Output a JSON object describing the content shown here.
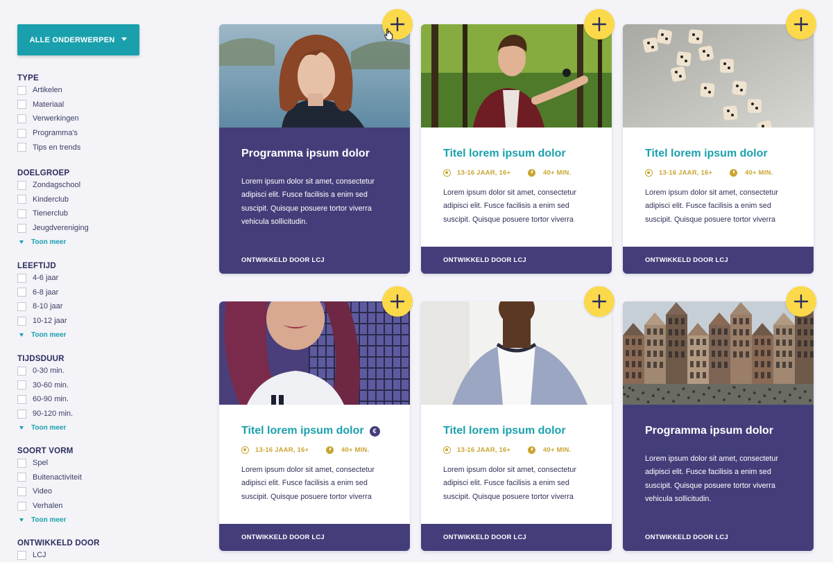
{
  "sidebar": {
    "topic_button": "ALLE ONDERWERPEN",
    "groups": [
      {
        "title": "TYPE",
        "options": [
          "Artikelen",
          "Materiaal",
          "Verwerkingen",
          "Programma's",
          "Tips en trends"
        ],
        "show_more": ""
      },
      {
        "title": "DOELGROEP",
        "options": [
          "Zondagschool",
          "Kinderclub",
          "Tienerclub",
          "Jeugdvereniging"
        ],
        "show_more": "Toon meer"
      },
      {
        "title": "LEEFTIJD",
        "options": [
          "4-6 jaar",
          "6-8 jaar",
          "8-10 jaar",
          "10-12 jaar"
        ],
        "show_more": "Toon meer"
      },
      {
        "title": "TIJDSDUUR",
        "options": [
          "0-30 min.",
          "30-60 min.",
          "60-90 min.",
          "90-120 min."
        ],
        "show_more": "Toon meer"
      },
      {
        "title": "SOORT VORM",
        "options": [
          "Spel",
          "Buitenactiviteit",
          "Video",
          "Verhalen"
        ],
        "show_more": "Toon meer"
      },
      {
        "title": "ONTWIKKELD DOOR",
        "options": [
          "LCJ"
        ],
        "show_more": ""
      }
    ]
  },
  "cards": [
    {
      "variant": "program",
      "image": "girl-portrait",
      "title": "Programma ipsum dolor",
      "euro": false,
      "age": "",
      "duration": "",
      "description": "Lorem ipsum dolor sit amet, consectetur adipisci elit. Fusce facilisis a enim sed suscipit. Quisque posuere tortor viverra vehicula sollicitudin.",
      "footer": "ONTWIKKELD DOOR LCJ"
    },
    {
      "variant": "article",
      "image": "boy-forest",
      "title": "Titel lorem ipsum dolor",
      "euro": false,
      "age": "13-16 JAAR, 16+",
      "duration": "40+ MIN.",
      "description": "Lorem ipsum dolor sit amet, consectetur adipisci elit. Fusce facilisis a enim sed suscipit. Quisque posuere tortor viverra",
      "footer": "ONTWIKKELD DOOR LCJ"
    },
    {
      "variant": "article",
      "image": "dice",
      "title": "Titel lorem ipsum dolor",
      "euro": false,
      "age": "13-16 JAAR, 16+",
      "duration": "40+ MIN.",
      "description": "Lorem ipsum dolor sit amet, consectetur adipisci elit. Fusce facilisis a enim sed suscipit. Quisque posuere tortor viverra",
      "footer": "ONTWIKKELD DOOR LCJ"
    },
    {
      "variant": "article",
      "image": "girl-fence",
      "title": "Titel lorem ipsum dolor",
      "euro": true,
      "euro_label": "€",
      "age": "13-16 JAAR, 16+",
      "duration": "40+ MIN.",
      "description": "Lorem ipsum dolor sit amet, consectetur adipisci elit. Fusce facilisis a enim sed suscipit. Quisque posuere tortor viverra",
      "footer": "ONTWIKKELD DOOR LCJ"
    },
    {
      "variant": "article",
      "image": "boy-blazer",
      "title": "Titel lorem ipsum dolor",
      "euro": false,
      "age": "13-16 JAAR, 16+",
      "duration": "40+ MIN.",
      "description": "Lorem ipsum dolor sit amet, consectetur adipisci elit. Fusce facilisis a enim sed suscipit. Quisque posuere tortor viverra",
      "footer": "ONTWIKKELD DOOR LCJ"
    },
    {
      "variant": "program",
      "image": "city-street",
      "title": "Programma ipsum dolor",
      "euro": false,
      "age": "",
      "duration": "",
      "description": "Lorem ipsum dolor sit amet, consectetur adipisci elit. Fusce facilisis a enim sed suscipit. Quisque posuere tortor viverra vehicula sollicitudin.",
      "footer": "ONTWIKKELD DOOR LCJ"
    }
  ],
  "colors": {
    "teal": "#1aa0ad",
    "navy": "#433e7a",
    "yellow": "#fbd94a",
    "gold": "#c9a531",
    "background": "#f3f3f8"
  },
  "icons": [
    "plus-icon",
    "target-icon",
    "clock-icon",
    "chevron-down-icon",
    "hand-cursor-icon"
  ]
}
